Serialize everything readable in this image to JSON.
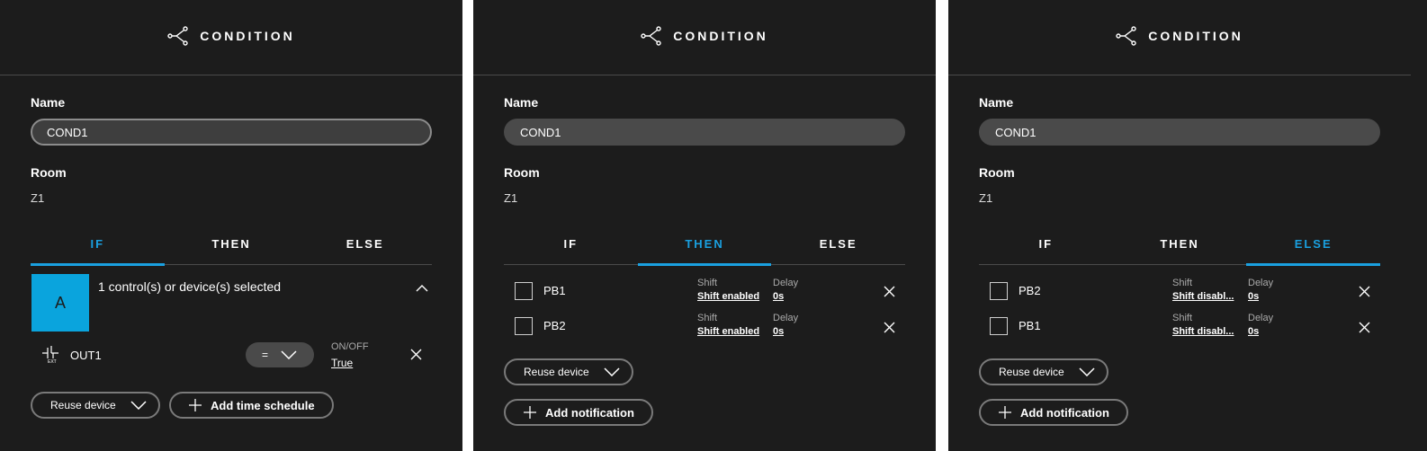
{
  "header": {
    "title": "CONDITION"
  },
  "labels": {
    "name": "Name",
    "room": "Room"
  },
  "name_value": "COND1",
  "room_value": "Z1",
  "tabs": [
    "IF",
    "THEN",
    "ELSE"
  ],
  "if_panel": {
    "tile_letter": "A",
    "selection_text": "1 control(s) or device(s) selected",
    "device_name": "OUT1",
    "operator": "=",
    "condition_label": "ON/OFF",
    "condition_value": "True",
    "reuse_label": "Reuse device",
    "add_schedule_label": "Add time schedule"
  },
  "then_panel": {
    "rows": [
      {
        "name": "PB1",
        "shift_label": "Shift",
        "shift_value": "Shift enabled",
        "delay_label": "Delay",
        "delay_value": "0s"
      },
      {
        "name": "PB2",
        "shift_label": "Shift",
        "shift_value": "Shift enabled",
        "delay_label": "Delay",
        "delay_value": "0s"
      }
    ],
    "reuse_label": "Reuse device",
    "add_notification_label": "Add notification"
  },
  "else_panel": {
    "rows": [
      {
        "name": "PB2",
        "shift_label": "Shift",
        "shift_value": "Shift disabl...",
        "delay_label": "Delay",
        "delay_value": "0s"
      },
      {
        "name": "PB1",
        "shift_label": "Shift",
        "shift_value": "Shift disabl...",
        "delay_label": "Delay",
        "delay_value": "0s"
      }
    ],
    "reuse_label": "Reuse device",
    "add_notification_label": "Add notification"
  },
  "colors": {
    "accent": "#1aa0e0",
    "tile": "#0aa4dd",
    "panel_bg": "#1c1c1c",
    "pill_bg": "#4a4a4a"
  }
}
